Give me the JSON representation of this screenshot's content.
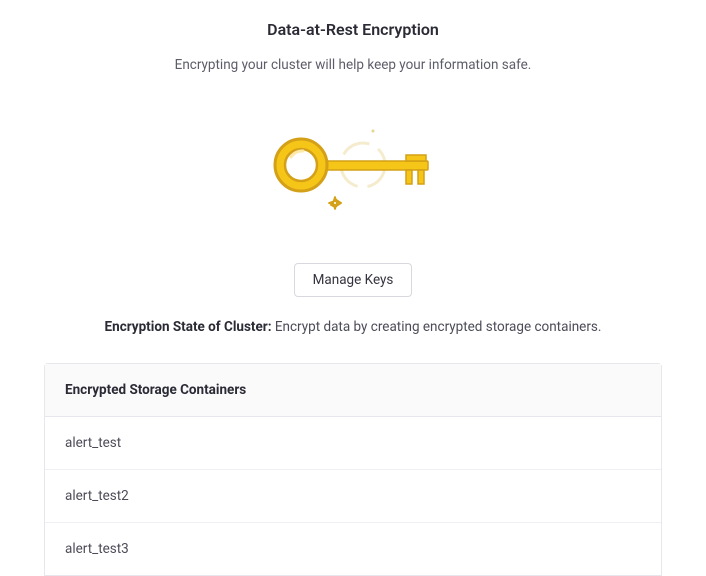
{
  "header": {
    "title": "Data-at-Rest Encryption",
    "subtitle": "Encrypting your cluster will help keep your information safe."
  },
  "actions": {
    "manage_keys_label": "Manage Keys"
  },
  "state": {
    "label": "Encryption State of Cluster:",
    "text": "Encrypt data by creating encrypted storage containers."
  },
  "containers_panel": {
    "header": "Encrypted Storage Containers",
    "rows": [
      {
        "name": "alert_test"
      },
      {
        "name": "alert_test2"
      },
      {
        "name": "alert_test3"
      }
    ]
  },
  "icons": {
    "key": "key-icon"
  }
}
